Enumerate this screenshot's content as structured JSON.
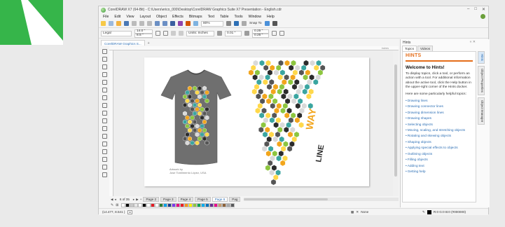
{
  "window": {
    "title": "CorelDRAW X7 (64-Bit) - C:\\Users\\erico_000\\Desktop\\CorelDRAW Graphics Suite X7 Presentation - English.cdr",
    "controls": [
      "–",
      "□",
      "✕"
    ]
  },
  "menu": [
    "File",
    "Edit",
    "View",
    "Layout",
    "Object",
    "Effects",
    "Bitmaps",
    "Text",
    "Table",
    "Tools",
    "Window",
    "Help"
  ],
  "toolbar": {
    "zoom": "80%",
    "snap_to": "Snap To",
    "colors": {
      "accent": "#2d6fb5",
      "brand": "#36b54a",
      "hint_orange": "#e46d1a"
    }
  },
  "property_bar": {
    "page_preset": "Legal",
    "width": "14.0 \"",
    "height": "8.5 \"",
    "units": "Units: Inches",
    "nudge": "0.01 \"",
    "dup_x": "0.25 \"",
    "dup_y": "0.25 \""
  },
  "document_tab": {
    "label": "CorelDRAW Graphics S..."
  },
  "page_nav": {
    "count": "6 of 35",
    "pages": [
      "Page 2",
      "Page 3",
      "Page 4",
      "Page 5",
      "Page 6",
      "Pag"
    ],
    "active_index": 4
  },
  "artwork": {
    "credit_line1": "Artwork by",
    "credit_line2": "Jose Tomlimento López, USA"
  },
  "palette_colors": [
    "#ffffff",
    "#000000",
    "#c8c8c8",
    "#e8e8e8",
    "#ffffff",
    "#000000",
    "#ffffff",
    "#e31b23",
    "#ffffff",
    "#2f7d32",
    "#00a0e9",
    "#1e3a8a",
    "#7c3aed",
    "#e6007e",
    "#ed1c24",
    "#f7941d",
    "#fff200",
    "#8dc63f",
    "#00a651",
    "#00aeef",
    "#0072bc",
    "#662d91",
    "#ec008c",
    "#c69c6d",
    "#8c6239",
    "#a7a9ac",
    "#58595b"
  ],
  "status": {
    "coords": "(14.477, 8.541 )",
    "fill": "None",
    "outline": "R:0 G:0 B:0 (#000000)"
  },
  "docker": {
    "title": "Hints",
    "tabs": [
      "Topics",
      "Videos"
    ],
    "side_tabs": [
      "Hints",
      "Object Properties",
      "Object Manager"
    ],
    "hints": {
      "heading": "HINTS",
      "welcome": "Welcome to Hints!",
      "intro": "To display topics, click a tool, or perform an action with a tool. For additional information about the active tool, click the Help button in the upper-right corner of the Hints docker.",
      "lead": "Here are some particularly helpful topics:",
      "topics": [
        "Drawing lines",
        "Drawing connector lines",
        "Drawing dimension lines",
        "Drawing shapes",
        "Selecting objects",
        "Moving, scaling, and stretching objects",
        "Rotating and skewing objects",
        "Shaping objects",
        "Applying special effects to objects",
        "Outlining objects",
        "Filling objects",
        "Adding text",
        "Getting help"
      ]
    }
  }
}
